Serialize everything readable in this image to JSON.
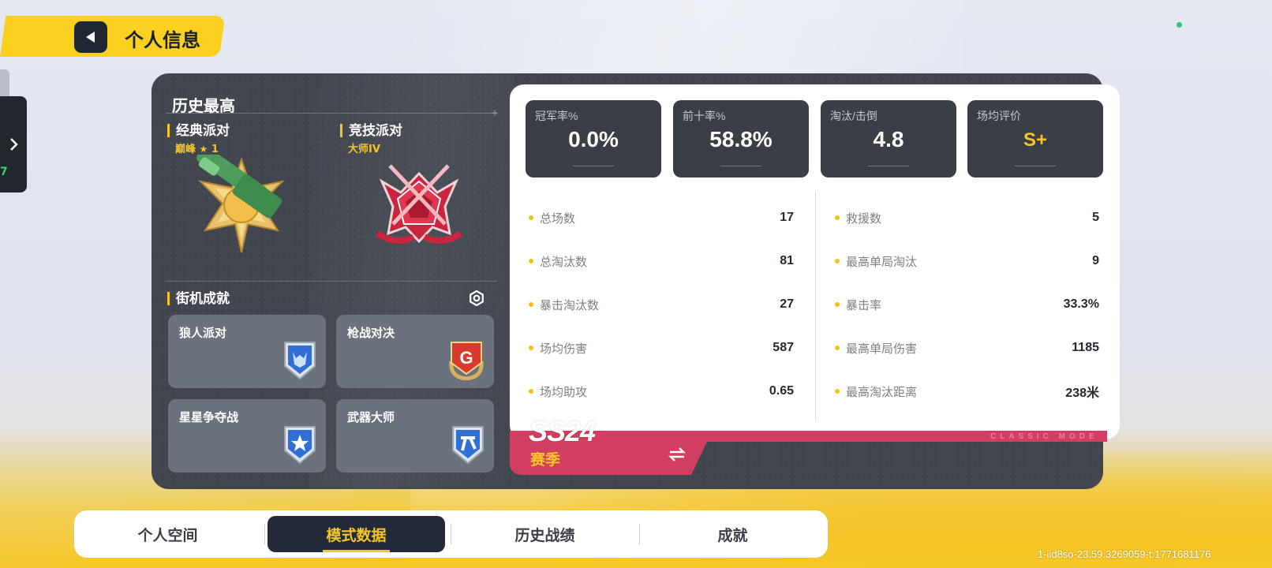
{
  "header": {
    "title": "个人信息"
  },
  "history": {
    "title": "历史最高",
    "classic": {
      "label": "经典派对",
      "rank": "巅峰",
      "star_count": "1"
    },
    "competitive": {
      "label": "竞技派对",
      "rank": "大师IV"
    }
  },
  "arcade": {
    "title": "街机成就",
    "modes": [
      {
        "label": "狼人派对",
        "icon": "wolf-emblem-icon"
      },
      {
        "label": "枪战对决",
        "icon": "g-emblem-icon"
      },
      {
        "label": "星星争夺战",
        "icon": "star-emblem-icon"
      },
      {
        "label": "武器大师",
        "icon": "weapon-emblem-icon"
      }
    ]
  },
  "top_stats": [
    {
      "label": "冠军率%",
      "value": "0.0%"
    },
    {
      "label": "前十率%",
      "value": "58.8%"
    },
    {
      "label": "淘汰/击倒",
      "value": "4.8"
    },
    {
      "label": "场均评价",
      "value": "S+"
    }
  ],
  "stats_left": [
    {
      "label": "总场数",
      "value": "17"
    },
    {
      "label": "总淘汰数",
      "value": "81"
    },
    {
      "label": "暴击淘汰数",
      "value": "27"
    },
    {
      "label": "场均伤害",
      "value": "587"
    },
    {
      "label": "场均助攻",
      "value": "0.65"
    }
  ],
  "stats_right": [
    {
      "label": "救援数",
      "value": "5"
    },
    {
      "label": "最高单局淘汰",
      "value": "9"
    },
    {
      "label": "暴击率",
      "value": "33.3%"
    },
    {
      "label": "最高单局伤害",
      "value": "1185"
    },
    {
      "label": "最高淘汰距离",
      "value": "238米"
    }
  ],
  "season": {
    "code": "SS24",
    "label": "赛季",
    "mode_tag": "CLASSIC MODE"
  },
  "tabs": [
    {
      "label": "个人空间",
      "active": false
    },
    {
      "label": "模式数据",
      "active": true
    },
    {
      "label": "历史战绩",
      "active": false
    },
    {
      "label": "成就",
      "active": false
    }
  ],
  "side_badge": "7",
  "build_id": "1-iid8so-23.59.3269059-t:1771681176",
  "colors": {
    "accent": "#f6c626",
    "season_red": "#d23e5f",
    "panel_dark": "#40454e",
    "tab_active": "#222a39"
  }
}
